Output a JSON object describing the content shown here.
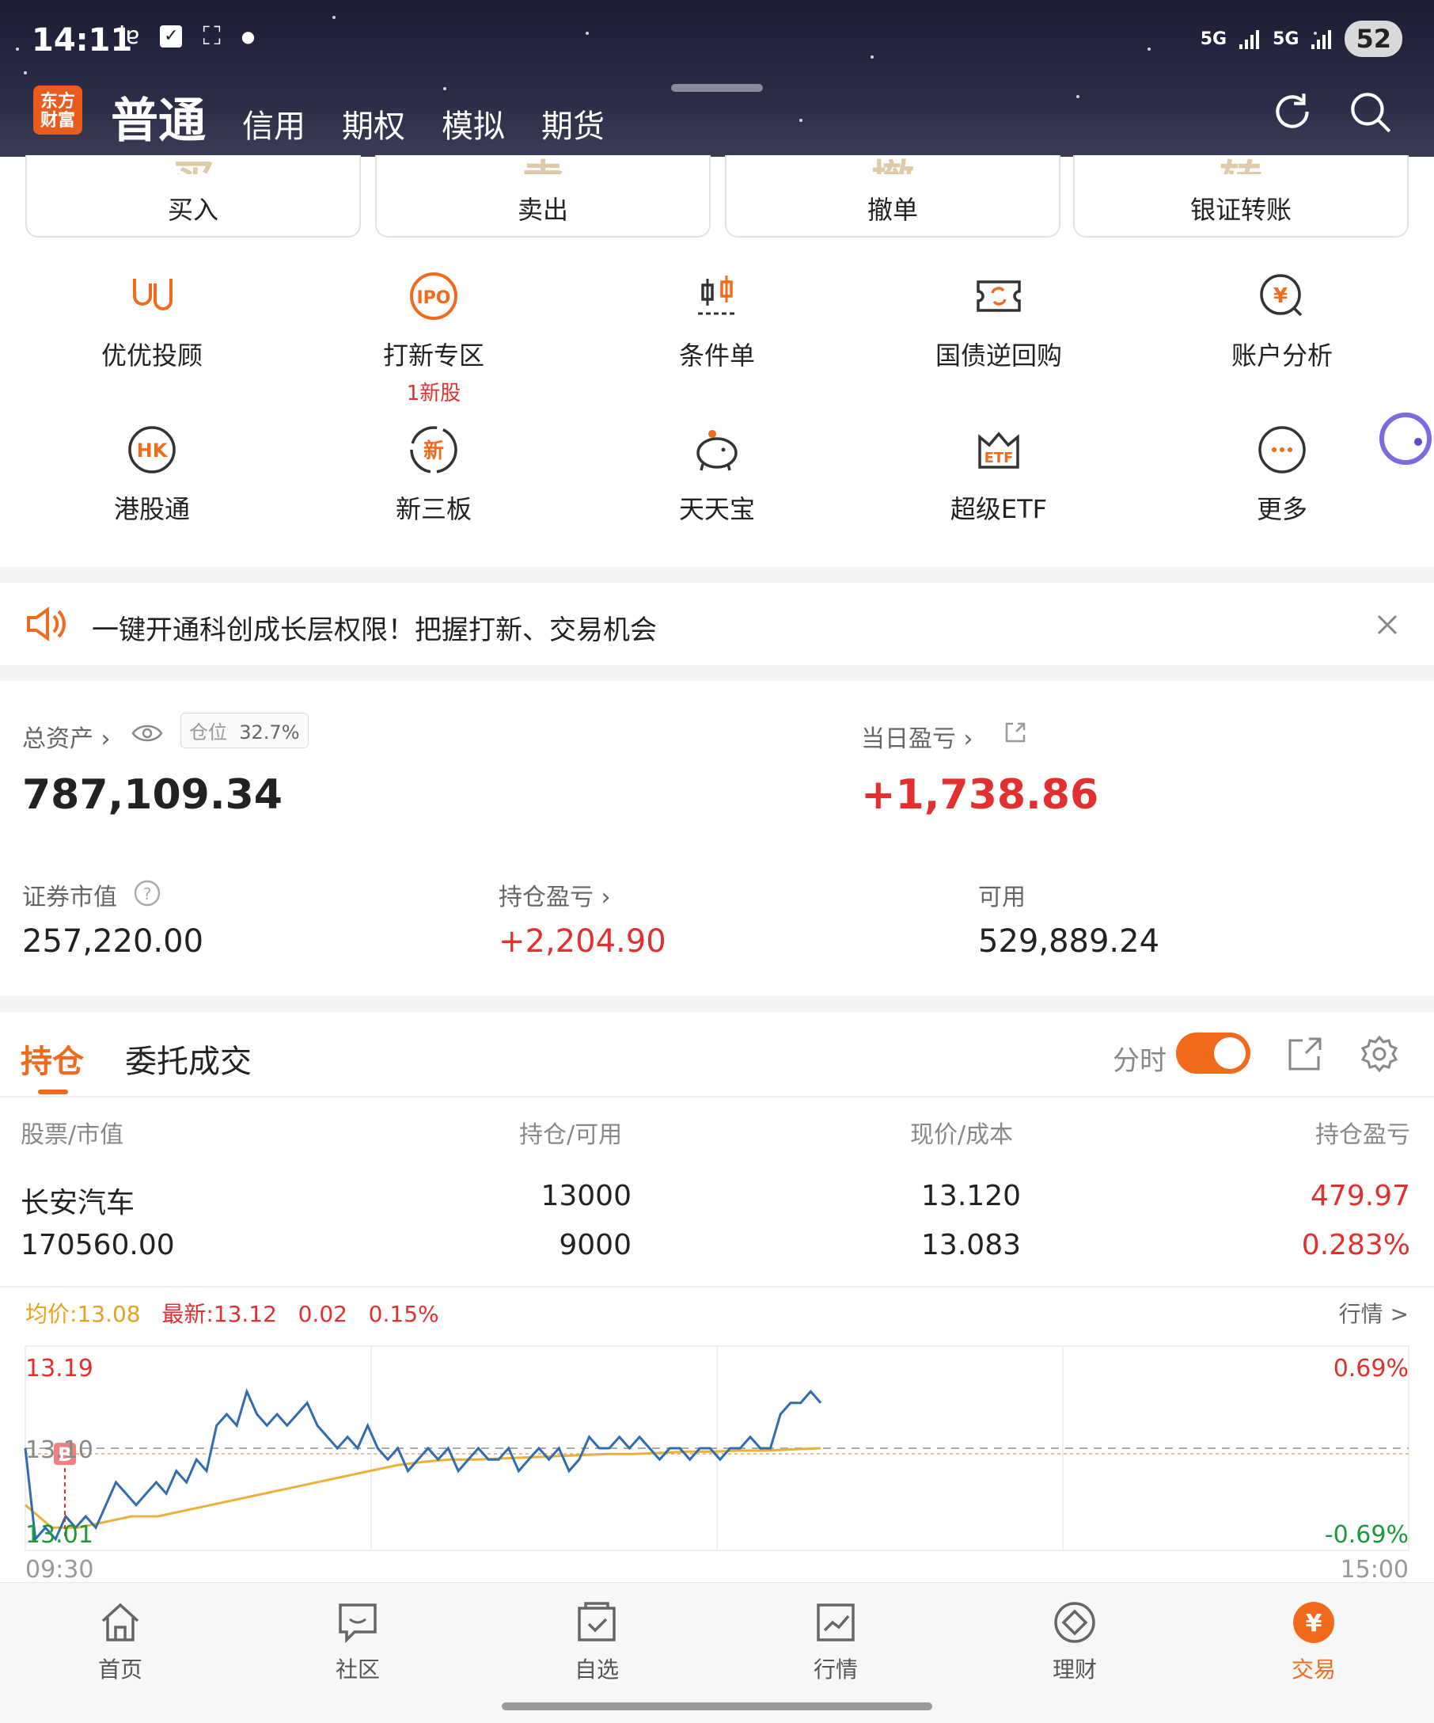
{
  "status_bar": {
    "time": "14:11",
    "net_left": "5G",
    "net_right": "5G",
    "battery": "52"
  },
  "header": {
    "logo_text_1": "东方",
    "logo_text_2": "财富",
    "tabs": [
      {
        "label": "普通",
        "active": true
      },
      {
        "label": "信用"
      },
      {
        "label": "期权"
      },
      {
        "label": "模拟"
      },
      {
        "label": "期货"
      }
    ]
  },
  "trade_buttons": [
    {
      "label": "买入",
      "ghost": "买"
    },
    {
      "label": "卖出",
      "ghost": "卖"
    },
    {
      "label": "撤单",
      "ghost": "撤"
    },
    {
      "label": "银证转账",
      "ghost": "转"
    }
  ],
  "features": [
    {
      "label": "优优投顾",
      "icon": "youyou-icon"
    },
    {
      "label": "打新专区",
      "icon": "ipo-icon",
      "sub": "1新股"
    },
    {
      "label": "条件单",
      "icon": "condition-order-icon"
    },
    {
      "label": "国债逆回购",
      "icon": "repo-icon"
    },
    {
      "label": "账户分析",
      "icon": "account-analysis-icon"
    },
    {
      "label": "港股通",
      "icon": "hk-icon"
    },
    {
      "label": "新三板",
      "icon": "neeq-icon"
    },
    {
      "label": "天天宝",
      "icon": "piggy-icon"
    },
    {
      "label": "超级ETF",
      "icon": "etf-icon"
    },
    {
      "label": "更多",
      "icon": "more-icon"
    }
  ],
  "notice": {
    "text": "一键开通科创成长层权限！把握打新、交易机会"
  },
  "assets": {
    "total_label": "总资产",
    "position_label": "仓位",
    "position_value": "32.7%",
    "total_value": "787,109.34",
    "daily_pl_label": "当日盈亏",
    "daily_pl_value": "+1,738.86",
    "market_value_label": "证券市值",
    "market_value": "257,220.00",
    "holding_pl_label": "持仓盈亏",
    "holding_pl_value": "+2,204.90",
    "available_label": "可用",
    "available_value": "529,889.24"
  },
  "positions": {
    "tab_holdings": "持仓",
    "tab_orders": "委托成交",
    "toggle_label": "分时",
    "toggle_on": true,
    "columns": [
      "股票/市值",
      "持仓/可用",
      "现价/成本",
      "持仓盈亏"
    ],
    "rows": [
      {
        "name": "长安汽车",
        "market_value": "170560.00",
        "holding": "13000",
        "available": "9000",
        "price": "13.120",
        "cost": "13.083",
        "pl": "479.97",
        "pl_pct": "0.283%"
      }
    ]
  },
  "chart_header": {
    "avg_label": "均价:",
    "avg_value": "13.08",
    "latest_label": "最新:",
    "latest_value": "13.12",
    "change": "0.02",
    "change_pct": "0.15%",
    "market_link": "行情 >"
  },
  "chart_data": {
    "type": "line",
    "y_ticks": [
      "13.19",
      "13.10",
      "13.01"
    ],
    "pct_ticks": [
      "0.69%",
      "-0.69%"
    ],
    "x_ticks": [
      "09:30",
      "15:00"
    ],
    "ylim": [
      13.01,
      13.19
    ],
    "ref_price": 13.1,
    "buy_marker": "B",
    "series": [
      {
        "name": "price",
        "color": "#2f6db0",
        "values": [
          13.1,
          13.02,
          13.03,
          13.02,
          13.04,
          13.03,
          13.04,
          13.03,
          13.05,
          13.07,
          13.06,
          13.05,
          13.06,
          13.07,
          13.06,
          13.08,
          13.07,
          13.09,
          13.08,
          13.12,
          13.13,
          13.12,
          13.15,
          13.13,
          13.12,
          13.13,
          13.12,
          13.13,
          13.14,
          13.12,
          13.11,
          13.1,
          13.11,
          13.1,
          13.12,
          13.1,
          13.09,
          13.1,
          13.08,
          13.09,
          13.1,
          13.09,
          13.1,
          13.08,
          13.09,
          13.1,
          13.09,
          13.09,
          13.1,
          13.08,
          13.09,
          13.1,
          13.09,
          13.1,
          13.08,
          13.09,
          13.11,
          13.1,
          13.1,
          13.11,
          13.1,
          13.11,
          13.1,
          13.09,
          13.1,
          13.1,
          13.09,
          13.1,
          13.1,
          13.09,
          13.1,
          13.1,
          13.11,
          13.1,
          13.1,
          13.13,
          13.14,
          13.14,
          13.15,
          13.14
        ]
      },
      {
        "name": "avg",
        "color": "#e8b23a",
        "values": [
          13.05,
          13.03,
          13.03,
          13.035,
          13.04,
          13.04,
          13.045,
          13.05,
          13.055,
          13.06,
          13.065,
          13.07,
          13.075,
          13.08,
          13.085,
          13.088,
          13.09,
          13.09,
          13.091,
          13.092,
          13.093,
          13.094,
          13.095,
          13.095,
          13.096,
          13.097,
          13.097,
          13.098,
          13.098,
          13.099,
          13.1
        ]
      }
    ]
  },
  "bottom_nav": [
    {
      "label": "首页",
      "icon": "home-icon"
    },
    {
      "label": "社区",
      "icon": "community-icon"
    },
    {
      "label": "自选",
      "icon": "watchlist-icon"
    },
    {
      "label": "行情",
      "icon": "market-icon"
    },
    {
      "label": "理财",
      "icon": "wealth-icon"
    },
    {
      "label": "交易",
      "icon": "trade-icon",
      "active": true
    }
  ],
  "colors": {
    "accent": "#f26b1d",
    "red": "#e23030",
    "green": "#1a9a3a"
  }
}
